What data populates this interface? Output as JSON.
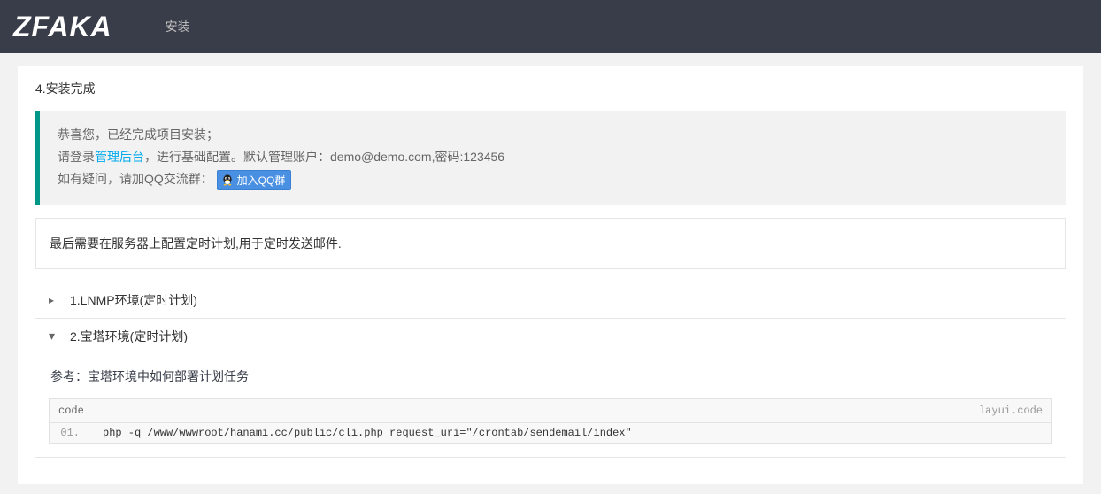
{
  "header": {
    "logo": "ZFAKA",
    "nav": "安装"
  },
  "section_title": "4.安装完成",
  "blockquote": {
    "line1": "恭喜您，已经完成项目安装；",
    "line2_prefix": "请登录",
    "line2_link": "管理后台",
    "line2_suffix": "，进行基础配置。默认管理账户：demo@demo.com,密码:123456",
    "line3_prefix": "如有疑问，请加QQ交流群：",
    "qq_btn_label": "加入QQ群"
  },
  "fieldset_legend": "最后需要在服务器上配置定时计划,用于定时发送邮件.",
  "collapse": {
    "items": [
      {
        "label": "1.LNMP环境(定时计划)",
        "expanded": false
      },
      {
        "label": "2.宝塔环境(定时计划)",
        "expanded": true
      }
    ]
  },
  "expanded_body": {
    "ref_label": "参考：",
    "ref_link": "宝塔环境中如何部署计划任务",
    "code": {
      "header_left": "code",
      "header_right": "layui.code",
      "lines": [
        {
          "num": "01.",
          "content": "php -q /www/wwwroot/hanami.cc/public/cli.php request_uri=\"/crontab/sendemail/index\""
        }
      ]
    }
  }
}
